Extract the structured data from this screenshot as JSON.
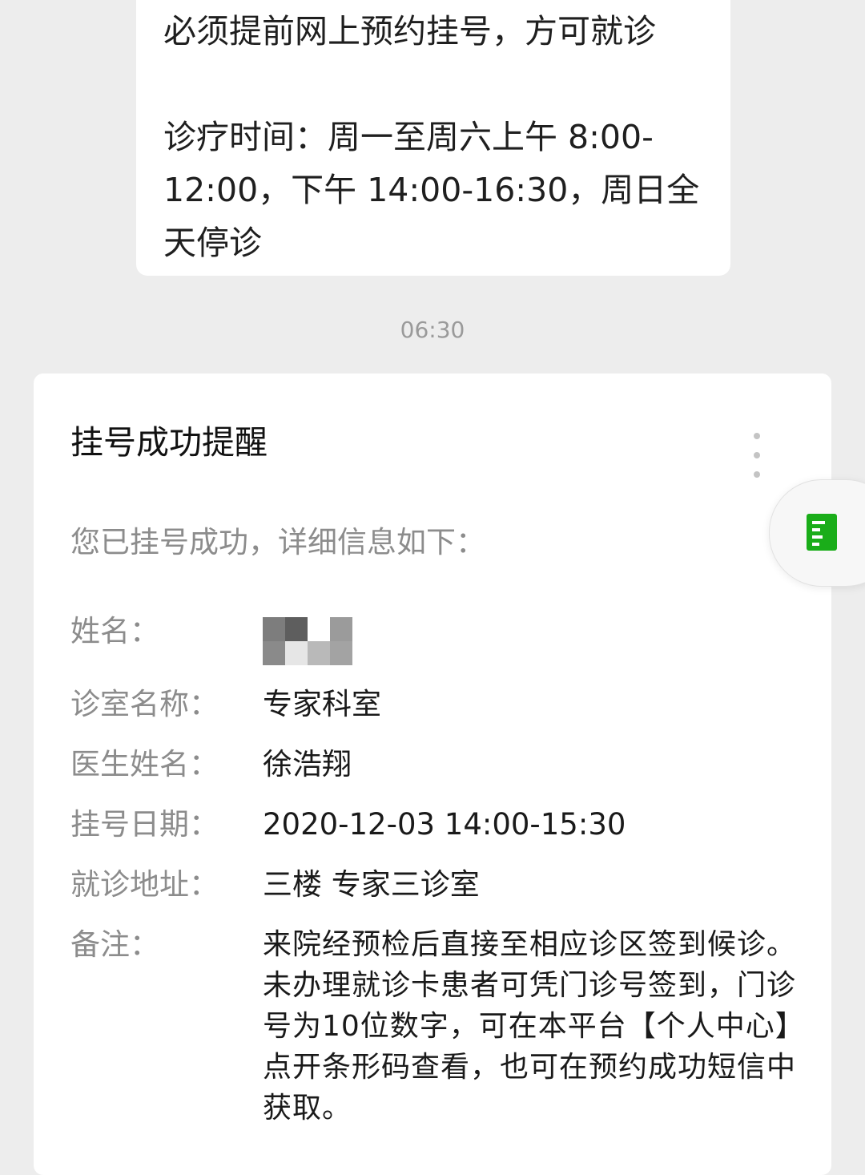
{
  "top_message": {
    "line1": "必须提前网上预约挂号，方可就诊",
    "hours": "诊疗时间：周一至周六上午 8:00-12:00，下午 14:00-16:30，周日全天停诊"
  },
  "timestamp": "06:30",
  "card": {
    "title": "挂号成功提醒",
    "intro": "您已挂号成功，详细信息如下：",
    "fields": {
      "name_label": "姓名：",
      "room_label": "诊室名称：",
      "room_value": "专家科室",
      "doctor_label": "医生姓名：",
      "doctor_value": "徐浩翔",
      "date_label": "挂号日期：",
      "date_value": "2020-12-03 14:00-15:30",
      "address_label": "就诊地址：",
      "address_value": "三楼 专家三诊室",
      "note_label": "备注：",
      "note_value": "来院经预检后直接至相应诊区签到候诊。未办理就诊卡患者可凭门诊号签到，门诊号为10位数字，可在本平台【个人中心】点开条形码查看，也可在预约成功短信中获取。"
    }
  },
  "icons": {
    "more": "more-vertical-icon",
    "float": "document-icon"
  },
  "colors": {
    "accent_green": "#1aad19",
    "background": "#ededed"
  }
}
